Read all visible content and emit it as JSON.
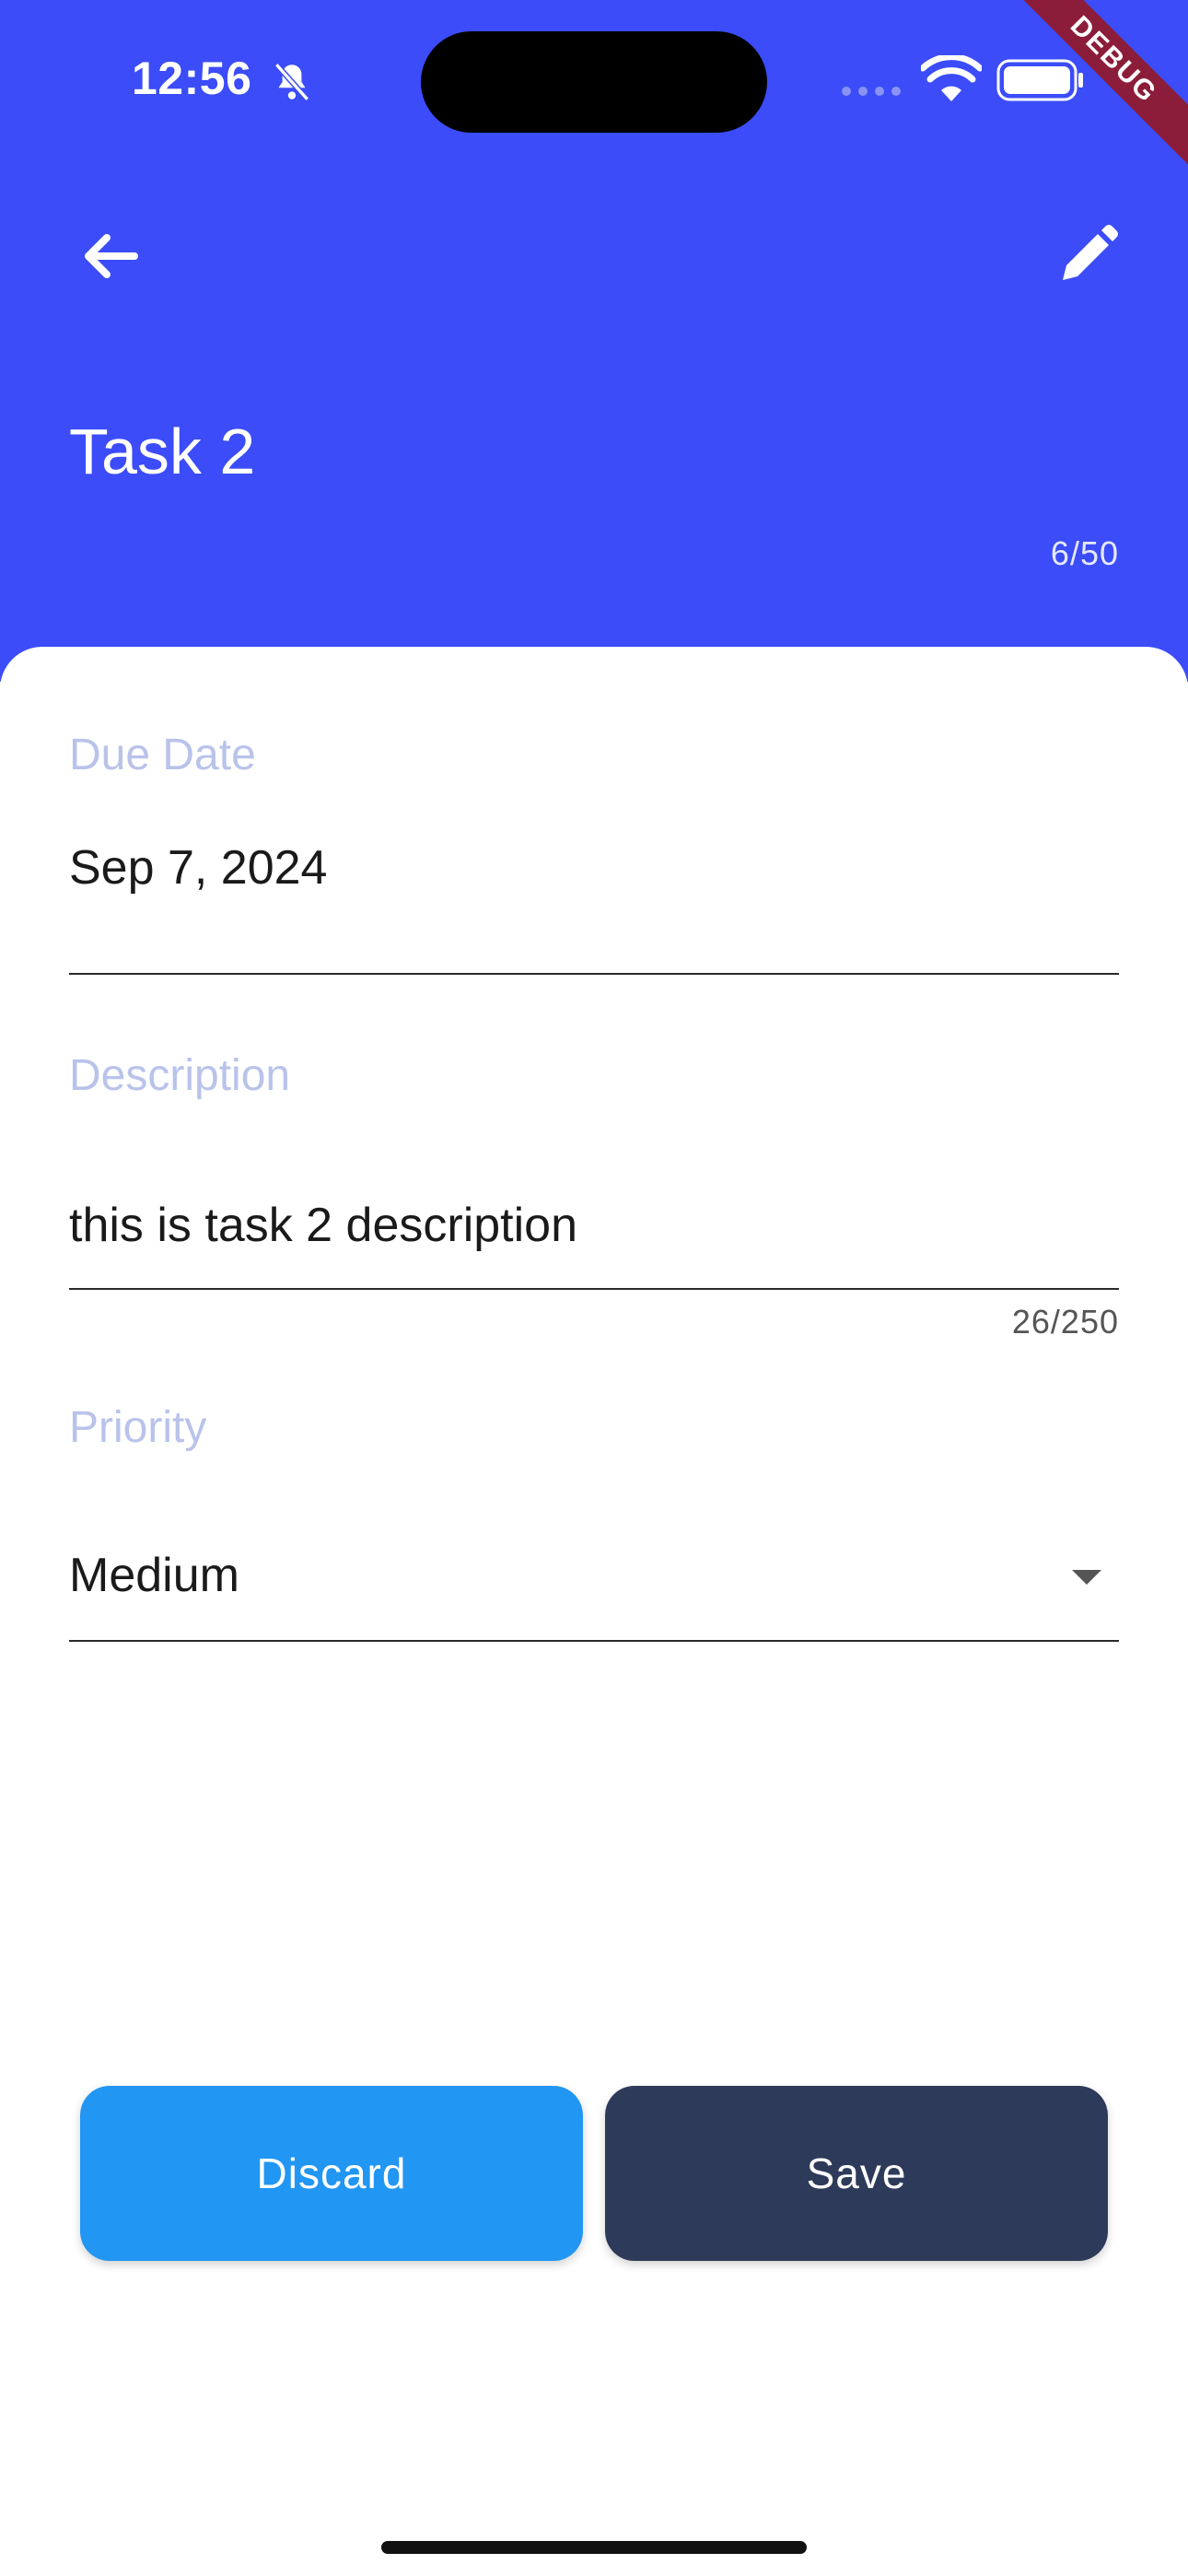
{
  "status_bar": {
    "time": "12:56",
    "icons": [
      "bell-slash-icon",
      "cellular-signal-icon",
      "wifi-icon",
      "battery-icon"
    ]
  },
  "debug_banner": "DEBUG",
  "app_bar": {
    "back_icon": "arrow-left-icon",
    "edit_icon": "pencil-icon"
  },
  "task": {
    "title": "Task 2",
    "title_counter": "6/50"
  },
  "form": {
    "due_date": {
      "label": "Due Date",
      "value": "Sep 7, 2024"
    },
    "description": {
      "label": "Description",
      "value": "this is task 2 description",
      "counter": "26/250"
    },
    "priority": {
      "label": "Priority",
      "value": "Medium"
    }
  },
  "actions": {
    "discard_label": "Discard",
    "save_label": "Save"
  },
  "colors": {
    "header": "#3b4cf8",
    "discard": "#2196f3",
    "save": "#2e3a59",
    "label": "#b9c3ea"
  }
}
